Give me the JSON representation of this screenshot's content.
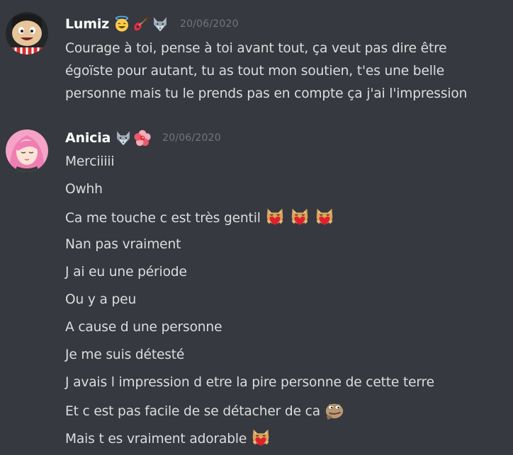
{
  "messages": [
    {
      "author": "Lumiz",
      "badges": [
        "smiling-face-with-halo",
        "guitar",
        "wolf-face"
      ],
      "timestamp": "20/06/2020",
      "lines": [
        "Courage à toi, pense à toi avant tout, ça veut pas dire être",
        "égoïste pour autant, tu as tout mon soutien, t'es une belle",
        "personne mais tu le prends pas en compte ça j'ai l'impression"
      ]
    },
    {
      "author": "Anicia",
      "badges": [
        "wolf-face",
        "hibiscus"
      ],
      "timestamp": "20/06/2020",
      "lines": [
        "Merciiiii",
        "Owhh",
        "Ca me touche c est très gentil",
        "Nan pas vraiment",
        "J ai eu une période",
        "Ou y a peu",
        "A cause d une personne",
        "Je me suis détesté",
        "J avais l impression d etre la pire personne de cette terre",
        "Et c est pas facile de se détacher de ca",
        "Mais t es vraiment adorable"
      ],
      "line_emojis": {
        "2": [
          "cat-heart-emoji",
          "cat-heart-emoji",
          "cat-heart-emoji"
        ],
        "9": [
          "pepe-frog-emoji"
        ],
        "10": [
          "cat-heart-emoji"
        ]
      }
    }
  ],
  "colors": {
    "background": "#36393f",
    "username": "#ffffff",
    "message_text": "#dcddde",
    "timestamp": "#72767d"
  }
}
